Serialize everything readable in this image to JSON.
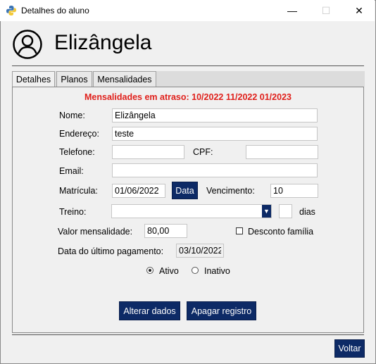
{
  "window": {
    "title": "Detalhes do aluno",
    "minimize": "—",
    "maximize": "☐",
    "close": "✕"
  },
  "header": {
    "name": "Elizângela"
  },
  "tabs": [
    {
      "label": "Detalhes",
      "active": true
    },
    {
      "label": "Planos",
      "active": false
    },
    {
      "label": "Mensalidades",
      "active": false
    }
  ],
  "alert": "Mensalidades em atraso:  10/2022 11/2022 01/2023",
  "form": {
    "nome_label": "Nome:",
    "nome_value": "Elizângela",
    "endereco_label": "Endereço:",
    "endereco_value": "teste",
    "telefone_label": "Telefone:",
    "telefone_value": "",
    "cpf_label": "CPF:",
    "cpf_value": "",
    "email_label": "Email:",
    "email_value": "",
    "matricula_label": "Matrícula:",
    "matricula_value": "01/06/2022",
    "data_button": "Data",
    "vencimento_label": "Vencimento:",
    "vencimento_value": "10",
    "treino_label": "Treino:",
    "treino_value": "",
    "dias_value": "",
    "dias_label": "dias",
    "valor_label": "Valor mensalidade:",
    "valor_value": "80,00",
    "desconto_label": "Desconto família",
    "desconto_checked": false,
    "ultimo_pag_label": "Data do último pagamento:",
    "ultimo_pag_value": "03/10/2022",
    "status_options": [
      {
        "label": "Ativo",
        "selected": true
      },
      {
        "label": "Inativo",
        "selected": false
      }
    ]
  },
  "buttons": {
    "alterar": "Alterar dados",
    "apagar": "Apagar registro",
    "voltar": "Voltar"
  },
  "colors": {
    "accent": "#0d2a66",
    "alert": "#e0201b"
  },
  "icons": {
    "app": "python-icon",
    "avatar": "user-circle-icon",
    "dropdown": "chevron-down-icon"
  }
}
